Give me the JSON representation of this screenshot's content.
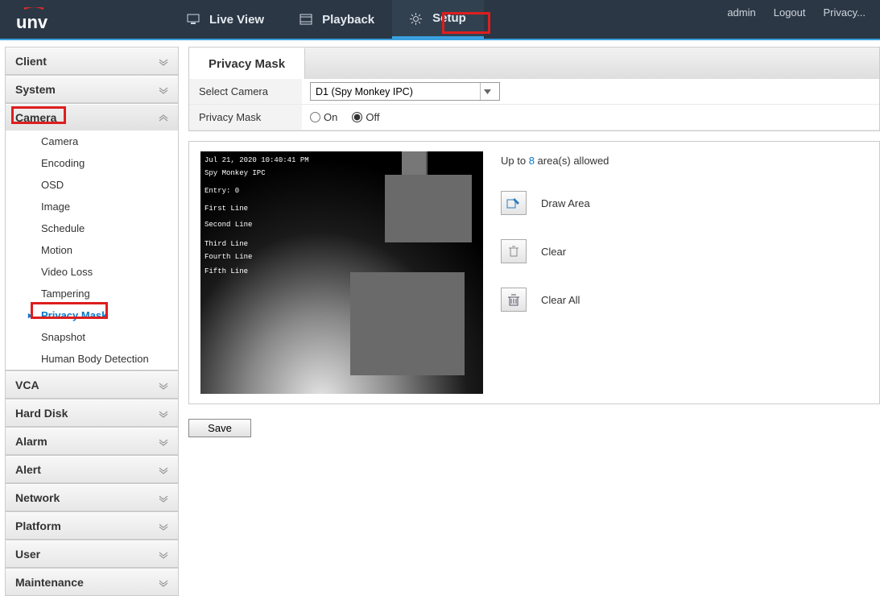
{
  "header": {
    "user": "admin",
    "logout": "Logout",
    "privacy": "Privacy...",
    "nav": {
      "live": "Live View",
      "playback": "Playback",
      "setup": "Setup"
    }
  },
  "sidebar": {
    "sections": {
      "client": "Client",
      "system": "System",
      "camera": "Camera",
      "vca": "VCA",
      "harddisk": "Hard Disk",
      "alarm": "Alarm",
      "alert": "Alert",
      "network": "Network",
      "platform": "Platform",
      "user": "User",
      "maintenance": "Maintenance"
    },
    "camera_items": {
      "camera": "Camera",
      "encoding": "Encoding",
      "osd": "OSD",
      "image": "Image",
      "schedule": "Schedule",
      "motion": "Motion",
      "videoloss": "Video Loss",
      "tampering": "Tampering",
      "privacymask": "Privacy Mask",
      "snapshot": "Snapshot",
      "humanbody": "Human Body Detection"
    }
  },
  "page": {
    "tab": "Privacy Mask",
    "select_camera_label": "Select Camera",
    "select_camera_value": "D1 (Spy Monkey IPC)",
    "privacy_mask_label": "Privacy Mask",
    "on": "On",
    "off": "Off",
    "hint_prefix": "Up to ",
    "hint_count": "8",
    "hint_suffix": " area(s) allowed",
    "draw_area": "Draw Area",
    "clear": "Clear",
    "clear_all": "Clear All",
    "save": "Save",
    "osd": {
      "timestamp": "Jul 21, 2020 10:40:41 PM",
      "camname": "Spy Monkey IPC",
      "entry": "Entry:  0",
      "l1": "First Line",
      "l2": "Second Line",
      "l3": "Third Line",
      "l4": "Fourth Line",
      "l5": "Fifth Line"
    }
  }
}
